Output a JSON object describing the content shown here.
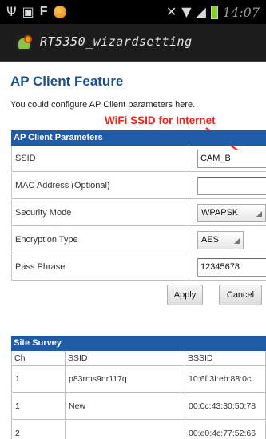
{
  "status_bar": {
    "left_icons": [
      "usb-icon",
      "flipboard-icon",
      "facebook-icon",
      "app-orange-icon"
    ],
    "right_icons": [
      "mute-icon",
      "wifi-icon",
      "signal-icon",
      "battery-icon"
    ],
    "time": "14:07"
  },
  "app": {
    "title": "RT5350_wizardsetting"
  },
  "page": {
    "title": "AP Client Feature",
    "intro": "You could configure AP Client parameters here.",
    "annotation": "WiFi SSID for Internet"
  },
  "params": {
    "header": "AP Client Parameters",
    "rows": [
      {
        "label": "SSID",
        "value": "CAM_B",
        "kind": "text"
      },
      {
        "label": "MAC Address (Optional)",
        "value": "",
        "kind": "text"
      },
      {
        "label": "Security Mode",
        "value": "WPAPSK",
        "kind": "select"
      },
      {
        "label": "Encryption Type",
        "value": "AES",
        "kind": "select"
      },
      {
        "label": "Pass Phrase",
        "value": "12345678",
        "kind": "text"
      }
    ]
  },
  "buttons": {
    "apply": "Apply",
    "cancel": "Cancel"
  },
  "survey": {
    "header": "Site Survey",
    "columns": [
      "Ch",
      "SSID",
      "BSSID"
    ],
    "rows": [
      {
        "ch": "1",
        "ssid": "p83rms9nr117q",
        "bssid": "10:6f:3f:eb:88:0c"
      },
      {
        "ch": "1",
        "ssid": "New",
        "bssid": "00:0c:43:30:50:78"
      },
      {
        "ch": "2",
        "ssid": "",
        "bssid": "00:e0:4c:77:52:66"
      }
    ]
  },
  "colors": {
    "accent": "#1f5ca8",
    "title": "#1a4f8c",
    "annotation": "#e8261b",
    "statusbar": "#000000"
  }
}
